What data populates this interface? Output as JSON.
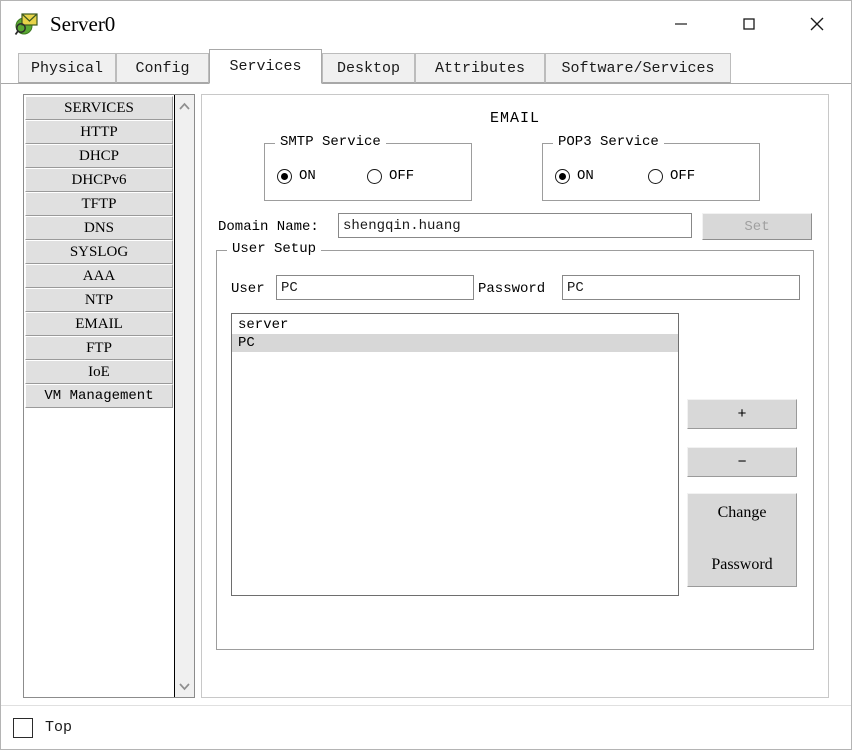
{
  "window": {
    "title": "Server0",
    "icon": "server-email-icon",
    "controls": {
      "minimize": "—",
      "maximize": "☐",
      "close": "✕"
    }
  },
  "tabs": [
    {
      "label": "Physical",
      "active": false
    },
    {
      "label": "Config",
      "active": false
    },
    {
      "label": "Services",
      "active": true
    },
    {
      "label": "Desktop",
      "active": false
    },
    {
      "label": "Attributes",
      "active": false
    },
    {
      "label": "Software/Services",
      "active": false
    }
  ],
  "sidebar": {
    "items": [
      {
        "label": "SERVICES"
      },
      {
        "label": "HTTP"
      },
      {
        "label": "DHCP"
      },
      {
        "label": "DHCPv6"
      },
      {
        "label": "TFTP"
      },
      {
        "label": "DNS"
      },
      {
        "label": "SYSLOG"
      },
      {
        "label": "AAA"
      },
      {
        "label": "NTP"
      },
      {
        "label": "EMAIL"
      },
      {
        "label": "FTP"
      },
      {
        "label": "IoE"
      },
      {
        "label": "VM Management"
      }
    ],
    "scroll": {
      "up": "⌃",
      "down": "⌄"
    }
  },
  "main": {
    "heading": "EMAIL",
    "smtp": {
      "legend": "SMTP Service",
      "on_label": "ON",
      "off_label": "OFF",
      "selected": "ON"
    },
    "pop3": {
      "legend": "POP3 Service",
      "on_label": "ON",
      "off_label": "OFF",
      "selected": "ON"
    },
    "domain": {
      "label": "Domain Name:",
      "value": "shengqin.huang",
      "placeholder": "",
      "set_label": "Set",
      "set_enabled": false
    },
    "user_setup": {
      "legend": "User Setup",
      "user_label": "User",
      "user_value": "PC",
      "password_label": "Password",
      "password_value": "PC",
      "users": [
        {
          "name": "server",
          "selected": false
        },
        {
          "name": "PC",
          "selected": true
        }
      ],
      "add_label": "+",
      "remove_label": "−",
      "change_password_line1": "Change",
      "change_password_line2": "Password"
    }
  },
  "footer": {
    "top_label": "Top",
    "top_checked": false
  },
  "colors": {
    "window_bg": "#ffffff",
    "button_face": "#d8d8d8",
    "sidebar_item": "#e0e0e0",
    "selection": "#d7d7d7",
    "border": "#9d9d9d",
    "disabled_text": "#a0a0a0"
  }
}
